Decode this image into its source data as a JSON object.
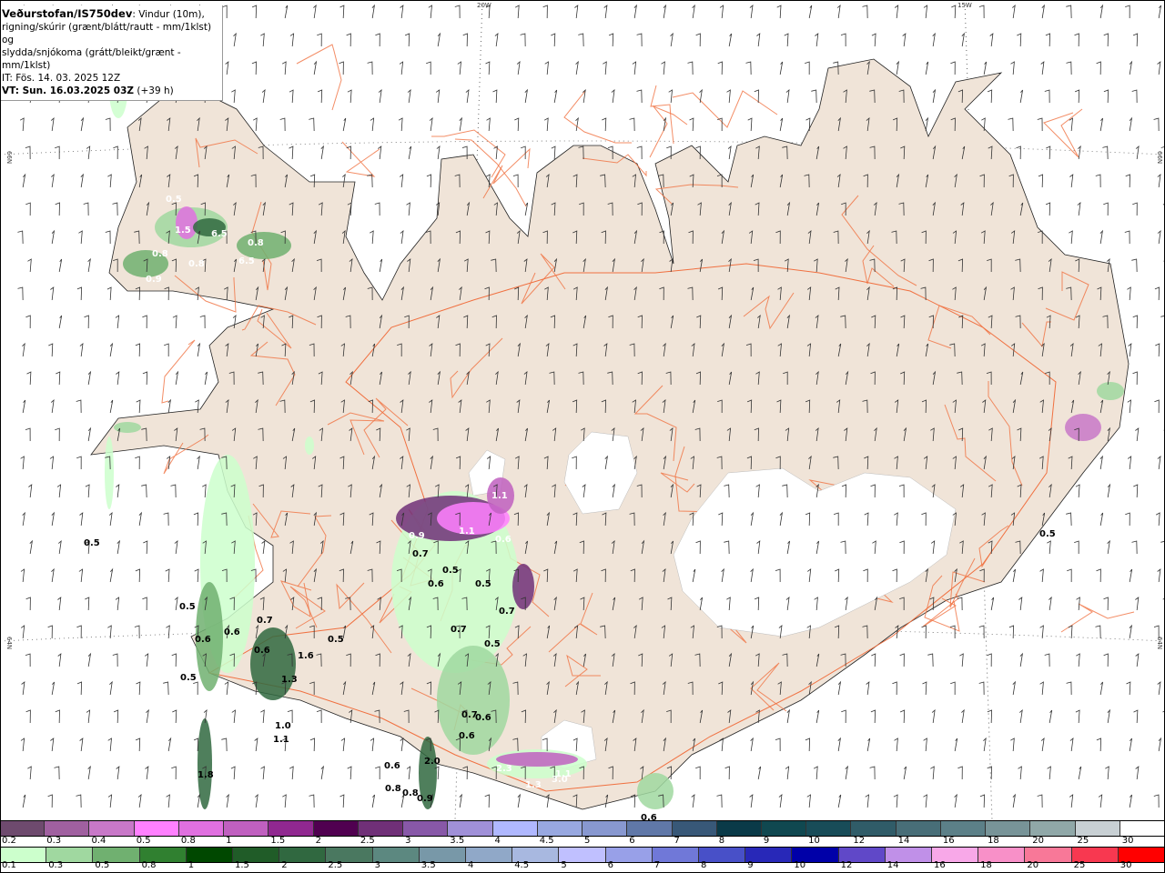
{
  "header": {
    "source": "Veðurstofan/IS750dev",
    "description_1": ": Vindur (10m),",
    "description_2": "rigning/skúrir (grænt/blátt/rautt - mm/1klst) og",
    "description_3": "slydda/snjókoma (grátt/bleikt/grænt - mm/1klst)",
    "initial_time": "IT: Fös. 14. 03. 2025 12Z",
    "valid_time": "VT: Sun. 16.03.2025 03Z",
    "lead_time": "(+39 h)"
  },
  "grid_labels": {
    "lon_20": "20W",
    "lon_15": "15W",
    "lat_66": "66N",
    "lat_64": "64N"
  },
  "map_labels": [
    "0.5",
    "1.5",
    "0.8",
    "0.8",
    "0.9",
    "6.5",
    "6.5",
    "0.8",
    "0.5",
    "0.5",
    "0.6",
    "0.6",
    "0.5",
    "0.7",
    "0.6",
    "1.6",
    "1.3",
    "1.0",
    "1.1",
    "1.8",
    "0.5",
    "1.1",
    "1.1",
    "0.9",
    "0.6",
    "0.7",
    "0.5",
    "0.7",
    "0.6",
    "0.5",
    "0.7",
    "0.5",
    "0.6",
    "0.7",
    "0.6",
    "0.6",
    "2.0",
    "0.8",
    "0.8",
    "0.9",
    "2.3",
    "1.3",
    "1.1",
    "3.0",
    "0.6",
    "0.5"
  ],
  "snow_legend": {
    "labels": [
      "0.2",
      "0.3",
      "0.4",
      "0.5",
      "0.8",
      "1",
      "1.5",
      "2",
      "2.5",
      "3",
      "3.5",
      "4",
      "4.5",
      "5",
      "6",
      "7",
      "8",
      "9",
      "10",
      "12",
      "14",
      "16",
      "18",
      "20",
      "25",
      "30"
    ],
    "colors": [
      "#6e4a6e",
      "#a060a0",
      "#c878c8",
      "#ff80ff",
      "#e070e0",
      "#c060c0",
      "#902890",
      "#500050",
      "#703078",
      "#8858a8",
      "#a090d8",
      "#b0b8ff",
      "#98a8e0",
      "#8898d0",
      "#6078a8",
      "#385878",
      "#0a3a48",
      "#104850",
      "#184c58",
      "#305c68",
      "#486e78",
      "#5c8088",
      "#789498",
      "#90a8a8",
      "#c8d0d4",
      "#ffffff"
    ]
  },
  "rain_legend": {
    "labels": [
      "0.1",
      "0.3",
      "0.5",
      "0.8",
      "1",
      "1.5",
      "2",
      "2.5",
      "3",
      "3.5",
      "4",
      "4.5",
      "5",
      "6",
      "7",
      "8",
      "9",
      "10",
      "12",
      "14",
      "16",
      "18",
      "20",
      "25",
      "30"
    ],
    "colors": [
      "#ccffcc",
      "#a0d8a0",
      "#70b070",
      "#308030",
      "#004800",
      "#205c28",
      "#306840",
      "#4a7860",
      "#5c8880",
      "#7898a8",
      "#90a8c8",
      "#a8b8e0",
      "#c0c0ff",
      "#98a0e8",
      "#7078d8",
      "#4850c8",
      "#2828b8",
      "#0000a8",
      "#6048c8",
      "#c090e8",
      "#f8a8e8",
      "#f890c8",
      "#f87898",
      "#f83850",
      "#ff0000"
    ]
  },
  "colors": {
    "land": "#f0e4d8",
    "glacier": "#ffffff",
    "roads": "#f07040",
    "sea": "#ffffff"
  }
}
